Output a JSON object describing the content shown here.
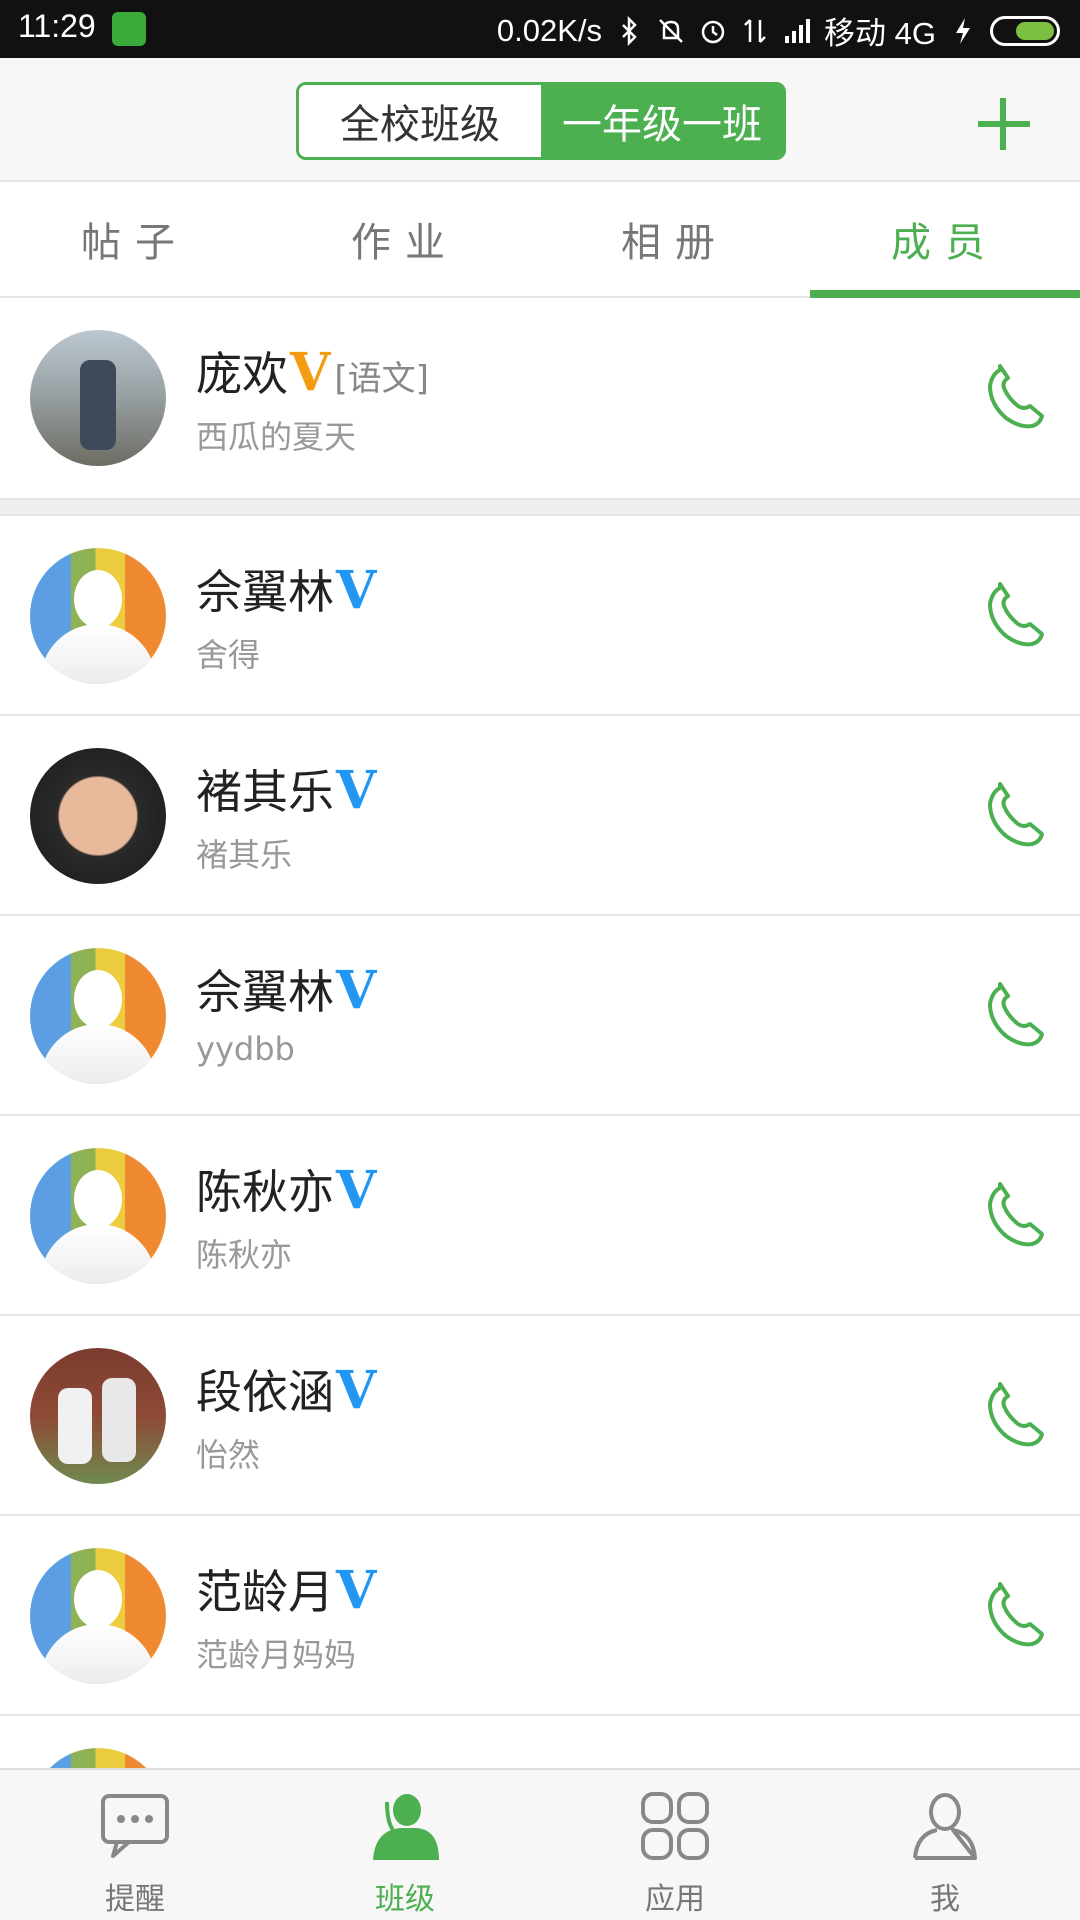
{
  "status_bar": {
    "time": "11:29",
    "network_speed": "0.02K/s",
    "carrier": "移动 4G",
    "icons": [
      "app-icon",
      "bluetooth-icon",
      "mute-icon",
      "alarm-icon",
      "data-icon",
      "signal-icon",
      "charging-icon",
      "battery-icon"
    ]
  },
  "header": {
    "segments": [
      {
        "label": "全校班级",
        "active": false
      },
      {
        "label": "一年级一班",
        "active": true
      }
    ],
    "add_icon": "plus-icon"
  },
  "tabs": [
    {
      "label": "帖子",
      "active": false
    },
    {
      "label": "作业",
      "active": false
    },
    {
      "label": "相册",
      "active": false
    },
    {
      "label": "成员",
      "active": true
    }
  ],
  "members": [
    {
      "name": "庞欢",
      "badge": "V",
      "badge_color": "#f39c12",
      "subject": "[语文]",
      "nickname": "西瓜的夏天",
      "avatar": "photo"
    },
    {
      "name": "佘翼林",
      "badge": "V",
      "badge_color": "#2196f3",
      "nickname": "舍得",
      "avatar": "default"
    },
    {
      "name": "褚其乐",
      "badge": "V",
      "badge_color": "#2196f3",
      "nickname": "褚其乐",
      "avatar": "photo"
    },
    {
      "name": "佘翼林",
      "badge": "V",
      "badge_color": "#2196f3",
      "nickname": "yydbb",
      "avatar": "default"
    },
    {
      "name": "陈秋亦",
      "badge": "V",
      "badge_color": "#2196f3",
      "nickname": "陈秋亦",
      "avatar": "default"
    },
    {
      "name": "段依涵",
      "badge": "V",
      "badge_color": "#2196f3",
      "nickname": "怡然",
      "avatar": "photo"
    },
    {
      "name": "范龄月",
      "badge": "V",
      "badge_color": "#2196f3",
      "nickname": "范龄月妈妈",
      "avatar": "default"
    }
  ],
  "bottom_nav": [
    {
      "label": "提醒",
      "icon": "chat-bubble-icon",
      "active": false
    },
    {
      "label": "班级",
      "icon": "class-person-icon",
      "active": true
    },
    {
      "label": "应用",
      "icon": "apps-grid-icon",
      "active": false
    },
    {
      "label": "我",
      "icon": "profile-icon",
      "active": false
    }
  ],
  "colors": {
    "accent": "#4caf50",
    "teacher_badge": "#f39c12",
    "member_badge": "#2196f3"
  }
}
